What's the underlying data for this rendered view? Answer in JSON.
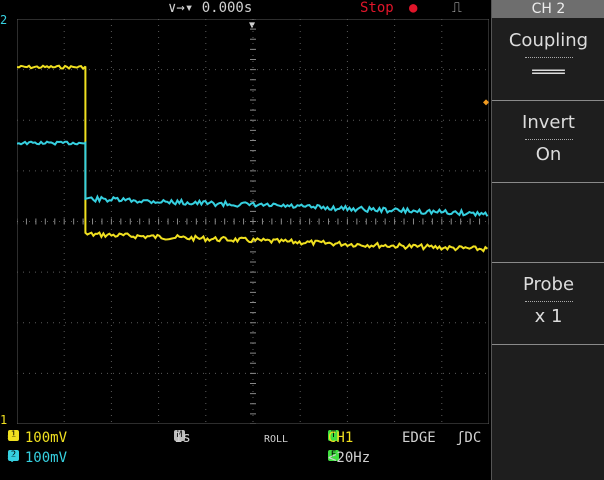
{
  "top": {
    "timebase_position": "∨→▾ 0.000s",
    "run_state": "Stop",
    "run_dot": "●",
    "trigger_edge": "⎍"
  },
  "markers": {
    "ch2": "2",
    "ch1": "1",
    "trigger_position": "▼",
    "trigger_level": "◆"
  },
  "menu": {
    "title": "CH 2",
    "buttons": [
      {
        "label": "Coupling",
        "value": "═══"
      },
      {
        "label": "Invert",
        "value": "On"
      },
      {
        "label": "",
        "value": ""
      },
      {
        "label": "Probe",
        "value": "x 1"
      },
      {
        "label": "",
        "value": ""
      }
    ]
  },
  "status": {
    "ch1_badge": "1",
    "ch1_scale": "═ 100mV",
    "ch2_prefix": "↓",
    "ch2_badge": "2",
    "ch2_scale": "═ 100mV",
    "timebase_badge": "M",
    "timebase": "1s",
    "mode": "ROLL",
    "trigger_badge": "T",
    "trigger_source": "CH1",
    "trigger_type": "EDGE",
    "trigger_coupling": "ʃDC",
    "filter_badge": "F",
    "trigger_filter": "<20Hz"
  },
  "colors": {
    "ch1": "#f0e020",
    "ch2": "#36d0e0",
    "grid": "#5a5a5a",
    "stop": "#e0152a"
  },
  "waveforms": {
    "ch1": {
      "before_level": 3.05,
      "step_time": 1.45,
      "after_start": 0.25,
      "after_end": 0.55
    },
    "ch2": {
      "before_level": 1.55,
      "step_time": 1.45,
      "after_start": 0.45,
      "after_end": 0.15
    }
  }
}
